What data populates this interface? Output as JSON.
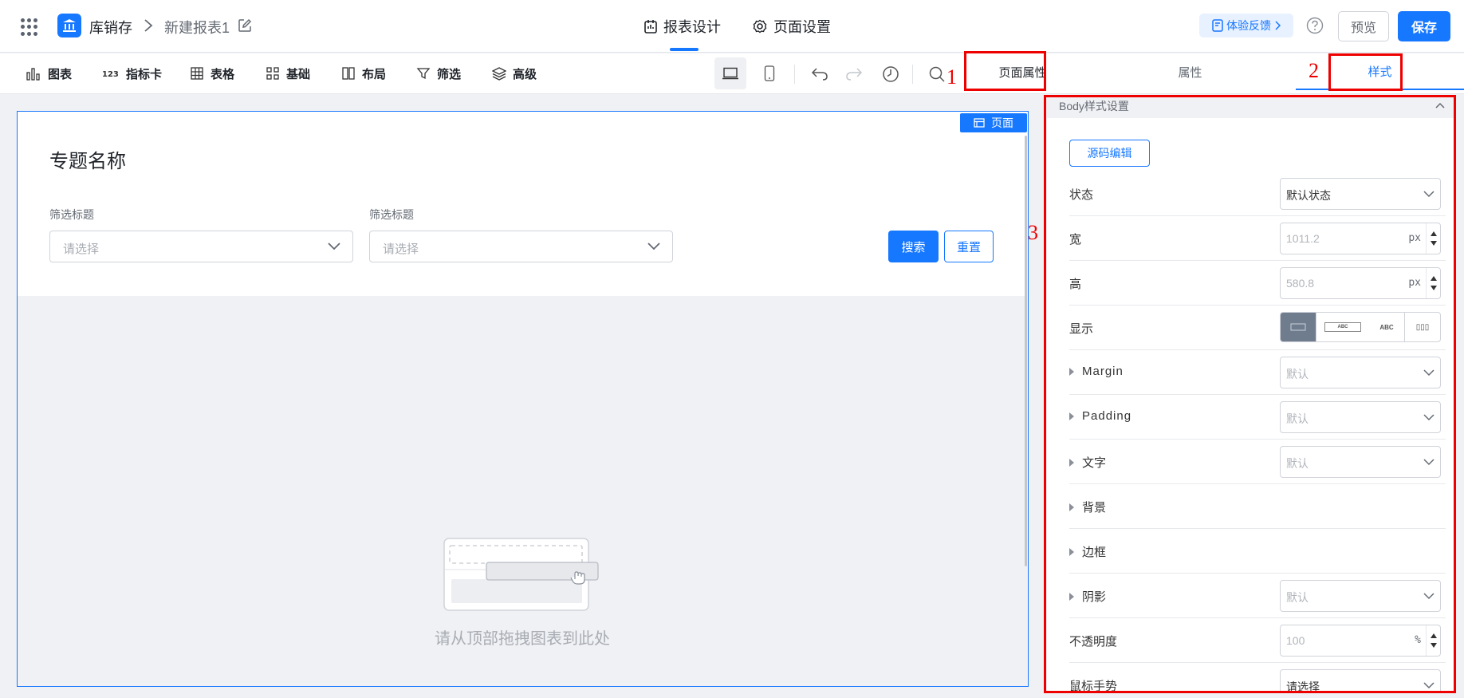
{
  "header": {
    "app_name": "库销存",
    "report_name": "新建报表1",
    "tabs": [
      {
        "label": "报表设计",
        "icon": "calendar-icon"
      },
      {
        "label": "页面设置",
        "icon": "gear-icon"
      }
    ],
    "feedback_label": "体验反馈",
    "preview_label": "预览",
    "save_label": "保存"
  },
  "toolbar": {
    "items": [
      {
        "label": "图表",
        "icon": "bar-chart-icon"
      },
      {
        "label": "指标卡",
        "icon": "kpi-card-icon"
      },
      {
        "label": "表格",
        "icon": "table-icon"
      },
      {
        "label": "基础",
        "icon": "grid-icon"
      },
      {
        "label": "布局",
        "icon": "layout-icon"
      },
      {
        "label": "筛选",
        "icon": "filter-icon"
      },
      {
        "label": "高级",
        "icon": "layers-icon"
      }
    ]
  },
  "panel_tabs": {
    "page_props": "页面属性",
    "props": "属性",
    "style": "样式"
  },
  "canvas": {
    "page_tag": "页面",
    "topic_title": "专题名称",
    "filters": [
      {
        "label": "筛选标题",
        "placeholder": "请选择"
      },
      {
        "label": "筛选标题",
        "placeholder": "请选择"
      }
    ],
    "search_label": "搜索",
    "reset_label": "重置",
    "empty_hint": "请从顶部拖拽图表到此处"
  },
  "style_panel": {
    "section_title": "Body样式设置",
    "source_edit_label": "源码编辑",
    "rows": {
      "state": {
        "label": "状态",
        "value": "默认状态"
      },
      "width": {
        "label": "宽",
        "value": "1011.2",
        "unit": "px"
      },
      "height": {
        "label": "高",
        "value": "580.8",
        "unit": "px"
      },
      "display": {
        "label": "显示",
        "options": [
          "",
          "ABC",
          "ABC",
          "▯▯▯"
        ]
      },
      "margin": {
        "label": "Margin",
        "value": "默认"
      },
      "padding": {
        "label": "Padding",
        "value": "默认"
      },
      "text": {
        "label": "文字",
        "value": "默认"
      },
      "background": {
        "label": "背景"
      },
      "border": {
        "label": "边框"
      },
      "shadow": {
        "label": "阴影",
        "value": "默认"
      },
      "opacity": {
        "label": "不透明度",
        "value": "100",
        "unit": "%"
      },
      "cursor": {
        "label": "鼠标手势",
        "value": "请选择"
      }
    }
  },
  "annotations": [
    "1",
    "2",
    "3"
  ],
  "colors": {
    "accent": "#1677ff",
    "annotation": "#ee0000"
  }
}
